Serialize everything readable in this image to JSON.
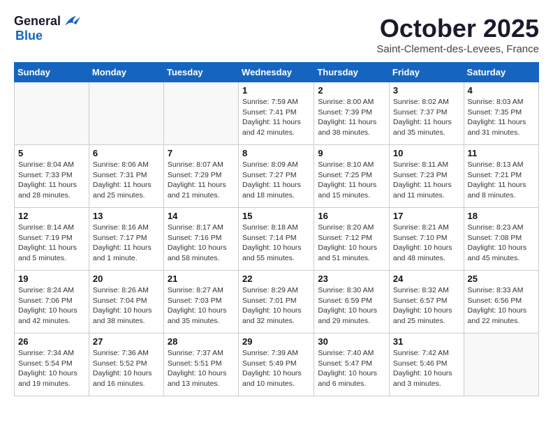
{
  "logo": {
    "general": "General",
    "blue": "Blue"
  },
  "header": {
    "month": "October 2025",
    "location": "Saint-Clement-des-Levees, France"
  },
  "weekdays": [
    "Sunday",
    "Monday",
    "Tuesday",
    "Wednesday",
    "Thursday",
    "Friday",
    "Saturday"
  ],
  "weeks": [
    [
      {
        "day": "",
        "info": ""
      },
      {
        "day": "",
        "info": ""
      },
      {
        "day": "",
        "info": ""
      },
      {
        "day": "1",
        "info": "Sunrise: 7:59 AM\nSunset: 7:41 PM\nDaylight: 11 hours\nand 42 minutes."
      },
      {
        "day": "2",
        "info": "Sunrise: 8:00 AM\nSunset: 7:39 PM\nDaylight: 11 hours\nand 38 minutes."
      },
      {
        "day": "3",
        "info": "Sunrise: 8:02 AM\nSunset: 7:37 PM\nDaylight: 11 hours\nand 35 minutes."
      },
      {
        "day": "4",
        "info": "Sunrise: 8:03 AM\nSunset: 7:35 PM\nDaylight: 11 hours\nand 31 minutes."
      }
    ],
    [
      {
        "day": "5",
        "info": "Sunrise: 8:04 AM\nSunset: 7:33 PM\nDaylight: 11 hours\nand 28 minutes."
      },
      {
        "day": "6",
        "info": "Sunrise: 8:06 AM\nSunset: 7:31 PM\nDaylight: 11 hours\nand 25 minutes."
      },
      {
        "day": "7",
        "info": "Sunrise: 8:07 AM\nSunset: 7:29 PM\nDaylight: 11 hours\nand 21 minutes."
      },
      {
        "day": "8",
        "info": "Sunrise: 8:09 AM\nSunset: 7:27 PM\nDaylight: 11 hours\nand 18 minutes."
      },
      {
        "day": "9",
        "info": "Sunrise: 8:10 AM\nSunset: 7:25 PM\nDaylight: 11 hours\nand 15 minutes."
      },
      {
        "day": "10",
        "info": "Sunrise: 8:11 AM\nSunset: 7:23 PM\nDaylight: 11 hours\nand 11 minutes."
      },
      {
        "day": "11",
        "info": "Sunrise: 8:13 AM\nSunset: 7:21 PM\nDaylight: 11 hours\nand 8 minutes."
      }
    ],
    [
      {
        "day": "12",
        "info": "Sunrise: 8:14 AM\nSunset: 7:19 PM\nDaylight: 11 hours\nand 5 minutes."
      },
      {
        "day": "13",
        "info": "Sunrise: 8:16 AM\nSunset: 7:17 PM\nDaylight: 11 hours\nand 1 minute."
      },
      {
        "day": "14",
        "info": "Sunrise: 8:17 AM\nSunset: 7:16 PM\nDaylight: 10 hours\nand 58 minutes."
      },
      {
        "day": "15",
        "info": "Sunrise: 8:18 AM\nSunset: 7:14 PM\nDaylight: 10 hours\nand 55 minutes."
      },
      {
        "day": "16",
        "info": "Sunrise: 8:20 AM\nSunset: 7:12 PM\nDaylight: 10 hours\nand 51 minutes."
      },
      {
        "day": "17",
        "info": "Sunrise: 8:21 AM\nSunset: 7:10 PM\nDaylight: 10 hours\nand 48 minutes."
      },
      {
        "day": "18",
        "info": "Sunrise: 8:23 AM\nSunset: 7:08 PM\nDaylight: 10 hours\nand 45 minutes."
      }
    ],
    [
      {
        "day": "19",
        "info": "Sunrise: 8:24 AM\nSunset: 7:06 PM\nDaylight: 10 hours\nand 42 minutes."
      },
      {
        "day": "20",
        "info": "Sunrise: 8:26 AM\nSunset: 7:04 PM\nDaylight: 10 hours\nand 38 minutes."
      },
      {
        "day": "21",
        "info": "Sunrise: 8:27 AM\nSunset: 7:03 PM\nDaylight: 10 hours\nand 35 minutes."
      },
      {
        "day": "22",
        "info": "Sunrise: 8:29 AM\nSunset: 7:01 PM\nDaylight: 10 hours\nand 32 minutes."
      },
      {
        "day": "23",
        "info": "Sunrise: 8:30 AM\nSunset: 6:59 PM\nDaylight: 10 hours\nand 29 minutes."
      },
      {
        "day": "24",
        "info": "Sunrise: 8:32 AM\nSunset: 6:57 PM\nDaylight: 10 hours\nand 25 minutes."
      },
      {
        "day": "25",
        "info": "Sunrise: 8:33 AM\nSunset: 6:56 PM\nDaylight: 10 hours\nand 22 minutes."
      }
    ],
    [
      {
        "day": "26",
        "info": "Sunrise: 7:34 AM\nSunset: 5:54 PM\nDaylight: 10 hours\nand 19 minutes."
      },
      {
        "day": "27",
        "info": "Sunrise: 7:36 AM\nSunset: 5:52 PM\nDaylight: 10 hours\nand 16 minutes."
      },
      {
        "day": "28",
        "info": "Sunrise: 7:37 AM\nSunset: 5:51 PM\nDaylight: 10 hours\nand 13 minutes."
      },
      {
        "day": "29",
        "info": "Sunrise: 7:39 AM\nSunset: 5:49 PM\nDaylight: 10 hours\nand 10 minutes."
      },
      {
        "day": "30",
        "info": "Sunrise: 7:40 AM\nSunset: 5:47 PM\nDaylight: 10 hours\nand 6 minutes."
      },
      {
        "day": "31",
        "info": "Sunrise: 7:42 AM\nSunset: 5:46 PM\nDaylight: 10 hours\nand 3 minutes."
      },
      {
        "day": "",
        "info": ""
      }
    ]
  ]
}
